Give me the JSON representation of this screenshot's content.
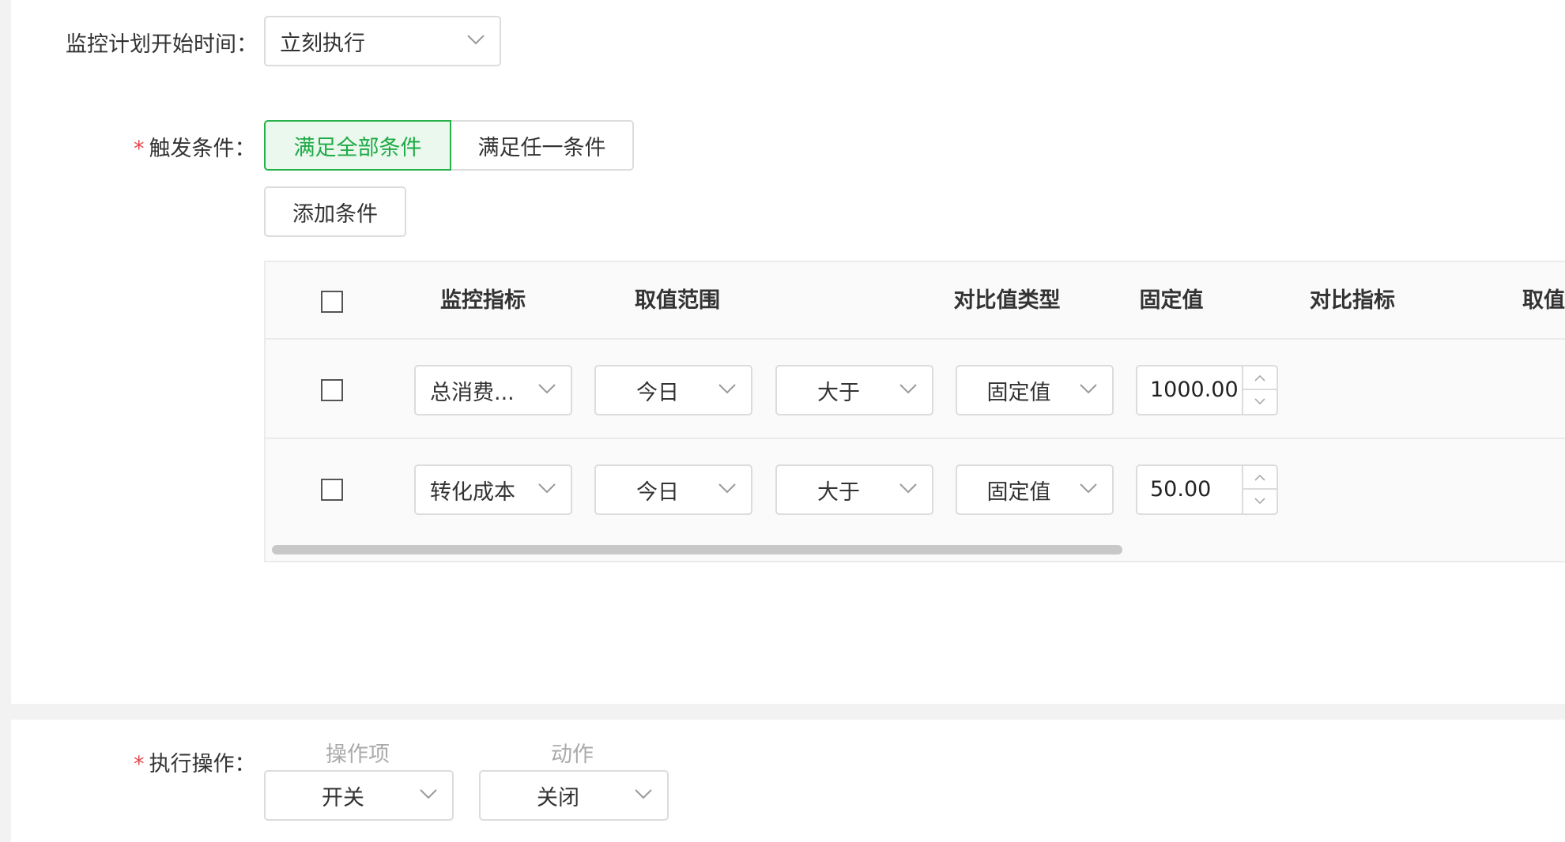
{
  "schedule": {
    "label": "监控计划开始时间：",
    "value": "立刻执行"
  },
  "trigger": {
    "label": "触发条件：",
    "required_mark": "*",
    "options": [
      "满足全部条件",
      "满足任一条件"
    ],
    "active_option": "满足全部条件",
    "add_button": "添加条件"
  },
  "table": {
    "columns": [
      "监控指标",
      "取值范围",
      "对比值类型",
      "固定值",
      "对比指标",
      "取值"
    ],
    "rows": [
      {
        "metric": "总消费...",
        "range": "今日",
        "operator": "大于",
        "compare_type": "固定值",
        "fixed_value": "1000.00"
      },
      {
        "metric": "转化成本",
        "range": "今日",
        "operator": "大于",
        "compare_type": "固定值",
        "fixed_value": "50.00"
      }
    ]
  },
  "action": {
    "label": "执行操作：",
    "required_mark": "*",
    "item_label": "操作项",
    "action_label": "动作",
    "item_value": "开关",
    "action_value": "关闭"
  },
  "colors": {
    "accent": "#27b148",
    "required": "#e5484d",
    "border": "#dcdcdc"
  }
}
